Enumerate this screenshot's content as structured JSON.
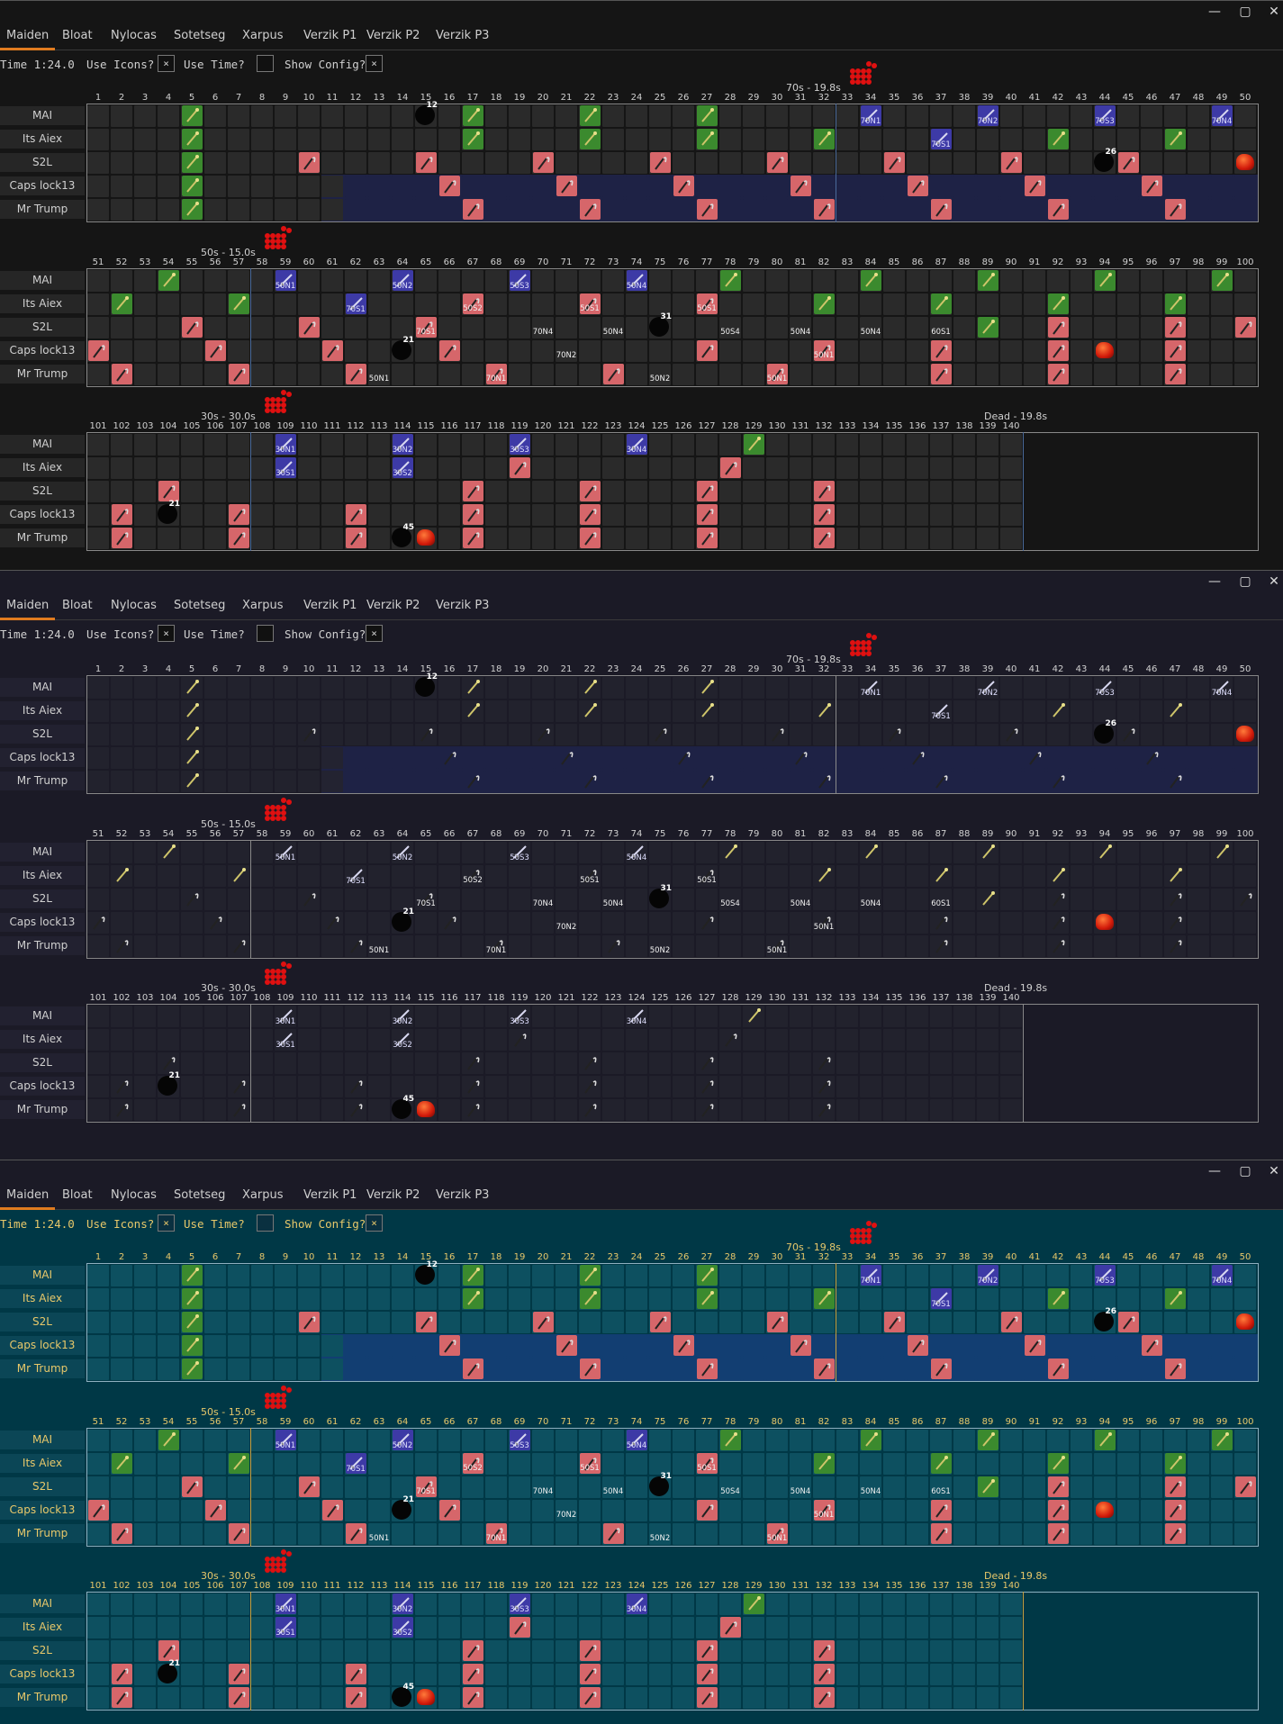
{
  "window_controls": {
    "minimize": "—",
    "maximize": "▢",
    "close": "✕"
  },
  "tabs": [
    "Maiden",
    "Bloat",
    "Nylocas",
    "Sotetseg",
    "Xarpus",
    "Verzik P1",
    "Verzik P2",
    "Verzik P3"
  ],
  "active_tab": "Maiden",
  "config": {
    "time_label": "Time 1:24.0",
    "use_icons_label": "Use Icons?",
    "use_icons_checked": "×",
    "use_time_label": "Use Time?",
    "use_time_checked": "",
    "show_config_label": "Show Config?",
    "show_config_checked": "×"
  },
  "players": [
    "MAI",
    "Its Aiex",
    "S2L",
    "Caps lock13",
    "Mr Trump"
  ],
  "rows": [
    {
      "start": 1,
      "end": 50,
      "marker": {
        "label": "70s - 19.8s",
        "at": 33
      }
    },
    {
      "start": 51,
      "end": 100,
      "marker": {
        "label": "50s - 15.0s",
        "at": 58
      }
    },
    {
      "start": 101,
      "end": 150,
      "marker": {
        "label": "30s - 30.0s",
        "at": 108
      },
      "dead": {
        "label": "Dead - 19.8s",
        "at": 140
      }
    }
  ],
  "themes": [
    {
      "name": "dark",
      "bg": "#151515",
      "cell": "#2a2a2a",
      "text": "#d0d0d0",
      "name_bg": "#262626",
      "hl": "#1e2245",
      "line": "#4a6a9a"
    },
    {
      "name": "navy",
      "bg": "#1b1a26",
      "cell": "#24232f",
      "text": "#d0d0d0",
      "name_bg": "#222130",
      "hl": "#1e2245",
      "line": "#8a8a8a"
    },
    {
      "name": "teal",
      "bg": "#003846",
      "cell": "#0d5060",
      "text": "#e8c86a",
      "name_bg": "#0b4656",
      "hl": "#123e72",
      "line": "#c8a040"
    }
  ],
  "attack_colors": {
    "green": "#3b8a2e",
    "red": "#d6666a",
    "blue": "#3d3aa6",
    "grey": "#6a6a6a"
  },
  "events": {
    "green": [
      [
        0,
        5
      ],
      [
        0,
        17
      ],
      [
        0,
        22
      ],
      [
        0,
        27
      ],
      [
        1,
        5
      ],
      [
        1,
        17
      ],
      [
        1,
        22
      ],
      [
        1,
        27
      ],
      [
        1,
        32
      ],
      [
        1,
        42
      ],
      [
        1,
        47
      ],
      [
        2,
        5
      ],
      [
        3,
        5
      ],
      [
        4,
        5
      ],
      [
        0,
        54
      ],
      [
        0,
        78
      ],
      [
        0,
        84
      ],
      [
        0,
        89
      ],
      [
        0,
        94
      ],
      [
        0,
        99
      ],
      [
        1,
        52
      ],
      [
        1,
        57
      ],
      [
        1,
        82
      ],
      [
        1,
        87
      ],
      [
        1,
        92
      ],
      [
        1,
        97
      ],
      [
        2,
        89
      ],
      [
        0,
        129
      ]
    ],
    "red": [
      [
        2,
        10
      ],
      [
        2,
        15
      ],
      [
        2,
        20
      ],
      [
        2,
        25
      ],
      [
        2,
        30
      ],
      [
        2,
        35
      ],
      [
        2,
        40
      ],
      [
        2,
        45
      ],
      [
        3,
        16
      ],
      [
        3,
        21
      ],
      [
        3,
        26
      ],
      [
        3,
        31
      ],
      [
        3,
        36
      ],
      [
        3,
        41
      ],
      [
        3,
        46
      ],
      [
        4,
        17
      ],
      [
        4,
        22
      ],
      [
        4,
        27
      ],
      [
        4,
        32
      ],
      [
        4,
        37
      ],
      [
        4,
        42
      ],
      [
        4,
        47
      ],
      [
        1,
        67
      ],
      [
        1,
        72
      ],
      [
        1,
        77
      ],
      [
        2,
        55
      ],
      [
        2,
        60
      ],
      [
        2,
        65
      ],
      [
        2,
        92
      ],
      [
        2,
        97
      ],
      [
        2,
        100
      ],
      [
        3,
        51
      ],
      [
        3,
        56
      ],
      [
        3,
        61
      ],
      [
        3,
        66
      ],
      [
        3,
        77
      ],
      [
        3,
        82
      ],
      [
        3,
        87
      ],
      [
        3,
        92
      ],
      [
        3,
        97
      ],
      [
        4,
        52
      ],
      [
        4,
        57
      ],
      [
        4,
        62
      ],
      [
        4,
        68
      ],
      [
        4,
        73
      ],
      [
        4,
        80
      ],
      [
        4,
        87
      ],
      [
        4,
        92
      ],
      [
        4,
        97
      ],
      [
        1,
        119
      ],
      [
        1,
        128
      ],
      [
        2,
        104
      ],
      [
        2,
        117
      ],
      [
        2,
        122
      ],
      [
        2,
        127
      ],
      [
        2,
        132
      ],
      [
        3,
        102
      ],
      [
        3,
        107
      ],
      [
        3,
        112
      ],
      [
        3,
        117
      ],
      [
        3,
        122
      ],
      [
        3,
        127
      ],
      [
        3,
        132
      ],
      [
        4,
        102
      ],
      [
        4,
        107
      ],
      [
        4,
        112
      ],
      [
        4,
        117
      ],
      [
        4,
        122
      ],
      [
        4,
        127
      ],
      [
        4,
        132
      ]
    ],
    "blue": [
      [
        0,
        34,
        "70N1"
      ],
      [
        0,
        39,
        "70N2"
      ],
      [
        0,
        44,
        "70S3"
      ],
      [
        0,
        49,
        "70N4"
      ],
      [
        1,
        37,
        "70S1"
      ],
      [
        0,
        59,
        "50N1"
      ],
      [
        0,
        64,
        "50N2"
      ],
      [
        0,
        69,
        "50S3"
      ],
      [
        0,
        74,
        "50N4"
      ],
      [
        1,
        62,
        "70S1"
      ],
      [
        0,
        109,
        "30N1"
      ],
      [
        0,
        114,
        "30N2"
      ],
      [
        0,
        119,
        "30S3"
      ],
      [
        0,
        124,
        "30N4"
      ],
      [
        1,
        109,
        "30S1"
      ],
      [
        1,
        114,
        "30S2"
      ]
    ],
    "labels": [
      [
        2,
        65,
        "70S1"
      ],
      [
        1,
        67,
        "50S2"
      ],
      [
        1,
        72,
        "50S1"
      ],
      [
        1,
        77,
        "50S1"
      ],
      [
        2,
        70,
        "70N4"
      ],
      [
        2,
        73,
        "50N4"
      ],
      [
        2,
        78,
        "50S4"
      ],
      [
        2,
        81,
        "50N4"
      ],
      [
        2,
        84,
        "50N4"
      ],
      [
        2,
        87,
        "60S1"
      ],
      [
        3,
        71,
        "70N2"
      ],
      [
        3,
        82,
        "50N1"
      ],
      [
        4,
        63,
        "50N1"
      ],
      [
        4,
        68,
        "70N1"
      ],
      [
        4,
        75,
        "50N2"
      ],
      [
        4,
        80,
        "50N1"
      ]
    ],
    "skulls": [
      [
        0,
        15,
        "12"
      ],
      [
        2,
        44,
        "26"
      ],
      [
        3,
        64,
        "21"
      ],
      [
        2,
        75,
        "31"
      ],
      [
        3,
        104,
        "21"
      ],
      [
        4,
        114,
        "45"
      ]
    ],
    "orbs": [
      [
        2,
        50
      ],
      [
        3,
        94
      ],
      [
        4,
        115
      ]
    ]
  }
}
